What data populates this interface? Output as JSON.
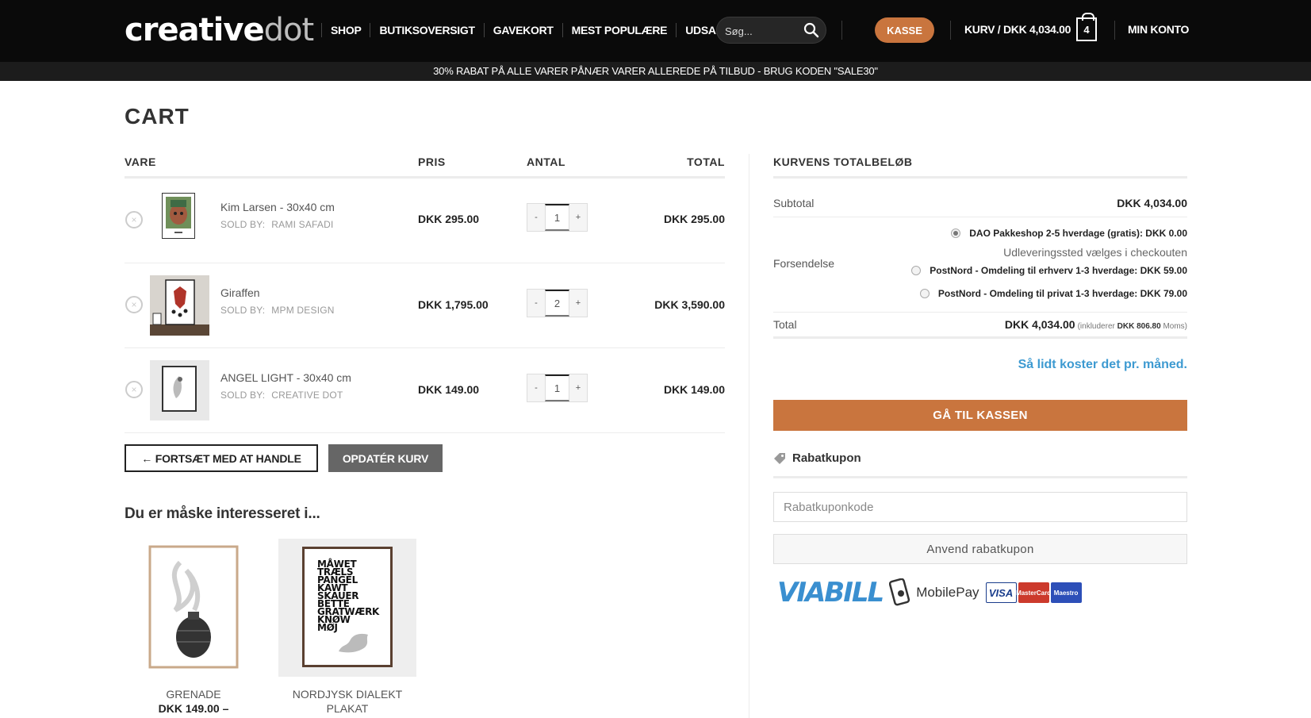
{
  "header": {
    "logo_main": "creative",
    "logo_accent": "dot",
    "nav": [
      "SHOP",
      "BUTIKSOVERSIGT",
      "GAVEKORT",
      "MEST POPULÆRE",
      "UDSALG"
    ],
    "search_placeholder": "Søg...",
    "checkout_label": "KASSE",
    "cart_label": "KURV / DKK 4,034.00",
    "cart_count": "4",
    "account_label": "MIN KONTO"
  },
  "promo": "30% RABAT PÅ ALLE VARER PÅNÆR VARER ALLEREDE PÅ TILBUD - BRUG KODEN \"SALE30\"",
  "page_title": "CART",
  "cart": {
    "headers": {
      "product": "VARE",
      "price": "PRIS",
      "qty": "ANTAL",
      "total": "TOTAL"
    },
    "sold_by_label": "SOLD BY:",
    "items": [
      {
        "name": "Kim Larsen - 30x40 cm",
        "seller": "RAMI SAFADI",
        "price": "DKK 295.00",
        "qty": "1",
        "total": "DKK 295.00",
        "minus": "-",
        "plus": "+",
        "remove": "×"
      },
      {
        "name": "Giraffen",
        "seller": "MPM DESIGN",
        "price": "DKK 1,795.00",
        "qty": "2",
        "total": "DKK 3,590.00",
        "minus": "-",
        "plus": "+",
        "remove": "×"
      },
      {
        "name": "ANGEL LIGHT - 30x40 cm",
        "seller": "CREATIVE DOT",
        "price": "DKK 149.00",
        "qty": "1",
        "total": "DKK 149.00",
        "minus": "-",
        "plus": "+",
        "remove": "×"
      }
    ],
    "continue_label": "← FORTSÆT MED AT HANDLE",
    "update_label": "OPDATÉR KURV"
  },
  "crosssell": {
    "title": "Du er måske interesseret i...",
    "items": [
      {
        "name": "GRENADE",
        "price": "DKK 149.00 –"
      },
      {
        "name": "NORDJYSK DIALEKT PLAKAT",
        "poster_words": [
          "MÅWET",
          "TRÆLS",
          "PANGEL",
          "KAWT",
          "SKAUER",
          "BETTE",
          "GRATWÆRK",
          "KNØW",
          "MØJ"
        ]
      }
    ]
  },
  "totals": {
    "title": "KURVENS TOTALBELØB",
    "subtotal_label": "Subtotal",
    "subtotal_value": "DKK 4,034.00",
    "shipping_label": "Forsendelse",
    "shipping_options": [
      {
        "label": "DAO Pakkeshop 2-5 hverdage (gratis): DKK 0.00",
        "checked": true
      },
      {
        "label": "PostNord - Omdeling til erhverv 1-3 hverdage: DKK 59.00",
        "checked": false
      },
      {
        "label": "PostNord - Omdeling til privat 1-3 hverdage: DKK 79.00",
        "checked": false
      }
    ],
    "shipping_note": "Udleveringssted vælges i checkouten",
    "total_label": "Total",
    "total_value": "DKK 4,034.00",
    "total_incl_prefix": "(inkluderer",
    "total_incl_vat": "DKK 806.80",
    "total_incl_suffix": "Moms)",
    "monthly_link": "Så lidt koster det pr. måned.",
    "checkout_btn": "GÅ TIL KASSEN",
    "coupon_title": "Rabatkupon",
    "coupon_placeholder": "Rabatkuponkode",
    "coupon_btn": "Anvend rabatkupon",
    "payments": {
      "viabill": "VIABILL",
      "mobilepay": "MobilePay",
      "visa": "VISA",
      "mastercard": "MasterCard",
      "maestro": "Maestro"
    }
  },
  "colors": {
    "accent": "#c9753e",
    "link": "#3d9ad1",
    "header_bg": "#0a0a0a"
  }
}
